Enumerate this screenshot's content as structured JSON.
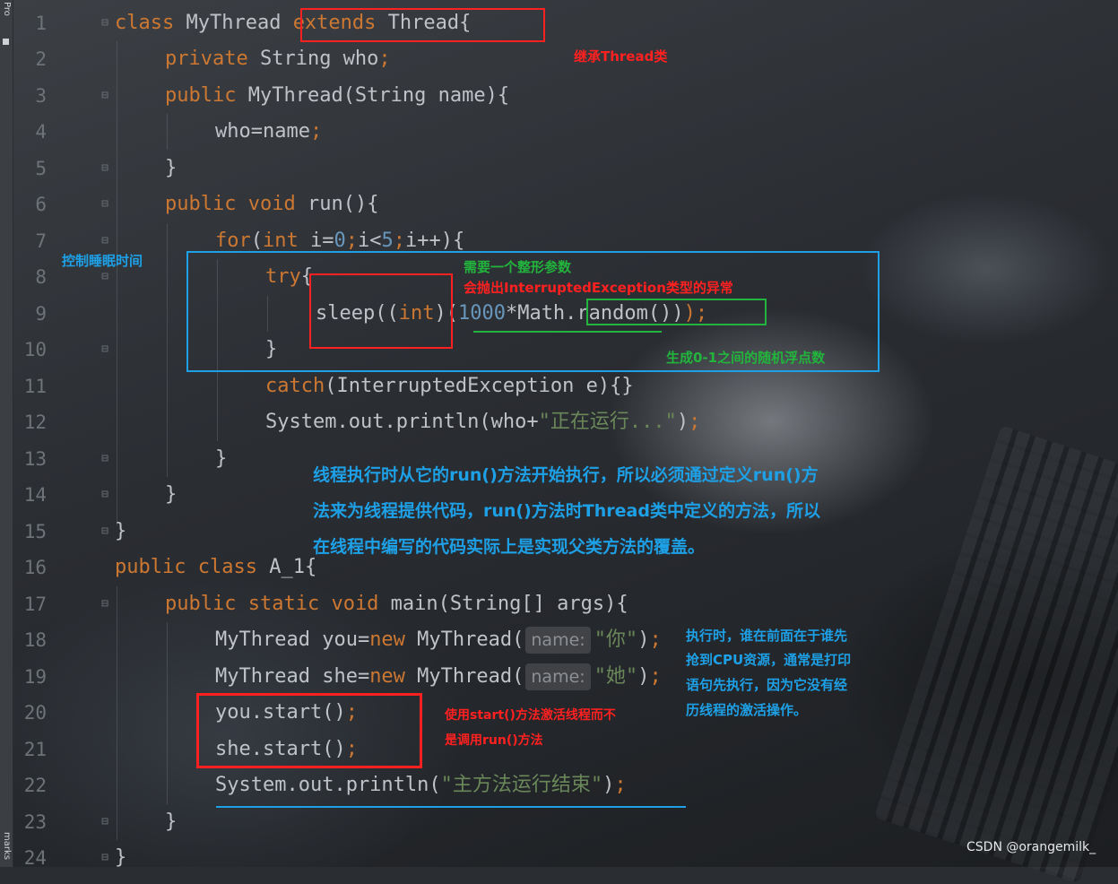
{
  "ide": {
    "left_tool_window_top": "Pro",
    "left_tool_window_bottom": "marks"
  },
  "line_numbers": [
    "1",
    "2",
    "3",
    "4",
    "5",
    "6",
    "7",
    "8",
    "9",
    "10",
    "11",
    "12",
    "13",
    "14",
    "15",
    "16",
    "17",
    "18",
    "19",
    "20",
    "21",
    "22",
    "23",
    "24"
  ],
  "code": {
    "l1": {
      "kw": "class",
      "t1": " MyThread ",
      "kw2": "extends",
      "t2": " Thread{"
    },
    "l2": {
      "kw": "private",
      "t1": " String who",
      "p": ";"
    },
    "l3": {
      "kw": "public",
      "t1": " MyThread(String name){"
    },
    "l4": {
      "t1": "who=name",
      "p": ";"
    },
    "l5": {
      "t1": "}"
    },
    "l6": {
      "kw": "public",
      "kw2": " void",
      "t1": " run(){"
    },
    "l7": {
      "kw": "for",
      "t1": "(",
      "kw2": "int",
      "t2": " i=",
      "n1": "0",
      "p1": ";",
      "t3": "i<",
      "n2": "5",
      "p2": ";",
      "t4": "i++){"
    },
    "l8": {
      "kw": "try",
      "t1": "{"
    },
    "l9": {
      "t1": "sleep((",
      "kw": "int",
      "t2": ")(",
      "n1": "1000",
      "t3": "*Math.random())",
      "p": ");"
    },
    "l10": {
      "t1": "}"
    },
    "l11": {
      "kw": "catch",
      "t1": "(InterruptedException e){}"
    },
    "l12": {
      "t1": "System.out.println(who+",
      "s": "\"正在运行...\"",
      "t2": ")",
      "p": ";"
    },
    "l13": {
      "t1": "}"
    },
    "l14": {
      "t1": "}"
    },
    "l15": {
      "t1": "}"
    },
    "l16": {
      "kw": "public",
      "kw2": " class",
      "t1": " A_1{"
    },
    "l17": {
      "kw": "public",
      "kw2": " static",
      "kw3": " void",
      "t1": " main(String[] args){"
    },
    "l18": {
      "t1": "MyThread you=",
      "kw": "new",
      "t2": " MyThread(",
      "hint": "name:",
      "s": "\"你\"",
      "t3": ")",
      "p": ";"
    },
    "l19": {
      "t1": "MyThread she=",
      "kw": "new",
      "t2": " MyThread(",
      "hint": "name:",
      "s": "\"她\"",
      "t3": ")",
      "p": ";"
    },
    "l20": {
      "t1": "you.start()",
      "p": ";"
    },
    "l21": {
      "t1": "she.start()",
      "p": ";"
    },
    "l22": {
      "t1": "System.out.println(",
      "s": "\"主方法运行结束\"",
      "t2": ")",
      "p": ";"
    },
    "l23": {
      "t1": "}"
    },
    "l24": {
      "t1": "}"
    }
  },
  "annotations": {
    "extends_note": "继承Thread类",
    "sleep_control_note": "控制睡眠时间",
    "int_param_note": "需要一个整形参数",
    "exception_note": "会抛出InterruptedException类型的异常",
    "random_note": "生成0-1之间的随机浮点数",
    "run_note_1": "线程执行时从它的run()方法开始执行，所以必须通过定义run()方",
    "run_note_2": "法来为线程提供代码，run()方法时Thread类中定义的方法，所以",
    "run_note_3": "在线程中编写的代码实际上是实现父类方法的覆盖。",
    "order_note_1": "执行时，谁在前面在于谁先",
    "order_note_2": "抢到CPU资源，通常是打印",
    "order_note_3": "语句先执行，因为它没有经",
    "order_note_4": "历线程的激活操作。",
    "start_note_1": "使用start()方法激活线程而不",
    "start_note_2": "是调用run()方法"
  },
  "watermark": "CSDN @orangemilk_",
  "colors": {
    "keyword": "#cc7832",
    "number": "#6897bb",
    "string": "#6a8759",
    "plain": "#bfc3c7",
    "annotation_red": "#ff2020",
    "annotation_blue": "#1ea0e6",
    "annotation_green": "#22b43c"
  }
}
